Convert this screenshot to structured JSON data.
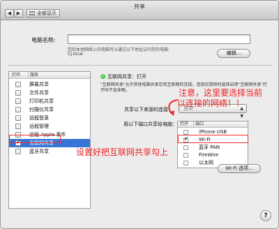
{
  "window": {
    "title": "共享",
    "show_all": "全部显示"
  },
  "computer_name": {
    "label": "电脑名称:",
    "value": "",
    "description": "您的本地网络上的电脑可以通过以下地址访问您的电脑:",
    "local_address": "CJ.local",
    "edit_button": "编辑..."
  },
  "services": {
    "header_on": "打开",
    "header_service": "服务",
    "items": [
      {
        "label": "屏幕共享",
        "checked": false,
        "selected": false
      },
      {
        "label": "文件共享",
        "checked": false,
        "selected": false
      },
      {
        "label": "打印机共享",
        "checked": false,
        "selected": false
      },
      {
        "label": "扫描仪共享",
        "checked": false,
        "selected": false
      },
      {
        "label": "远程登录",
        "checked": false,
        "selected": false
      },
      {
        "label": "远程管理",
        "checked": false,
        "selected": false
      },
      {
        "label": "远程 Apple 事件",
        "checked": false,
        "selected": false
      },
      {
        "label": "互联网共享",
        "checked": true,
        "selected": true
      },
      {
        "label": "蓝牙共享",
        "checked": false,
        "selected": false
      }
    ]
  },
  "detail": {
    "status": "互联网共享：打开",
    "status_color": "#2ea82e",
    "description": "\"互联网共享\"允许其他电脑共享您到互联网的连接。连接仅提供时选择启用\"互联网共享\"打开时不会休眠。",
    "share_from_label": "共享以下来源的连接：",
    "share_from_value": "宽带",
    "share_to_label": "用以下端口共享给电脑：",
    "ports_header_on": "打开",
    "ports_header_port": "端口",
    "ports": [
      {
        "label": "iPhone USB",
        "checked": false
      },
      {
        "label": "Wi-Fi",
        "checked": true
      },
      {
        "label": "蓝牙 PAN",
        "checked": false
      },
      {
        "label": "FireWire",
        "checked": false
      },
      {
        "label": "以太网",
        "checked": false
      }
    ],
    "wifi_options_button": "Wi-Fi 选项..."
  },
  "annotations": {
    "note_line1": "注意，这里要选择当前",
    "note_line2": "以连接的网络！！",
    "note_check": "设置好把互联网共享勾上",
    "color": "#e22222"
  },
  "help_label": "?"
}
